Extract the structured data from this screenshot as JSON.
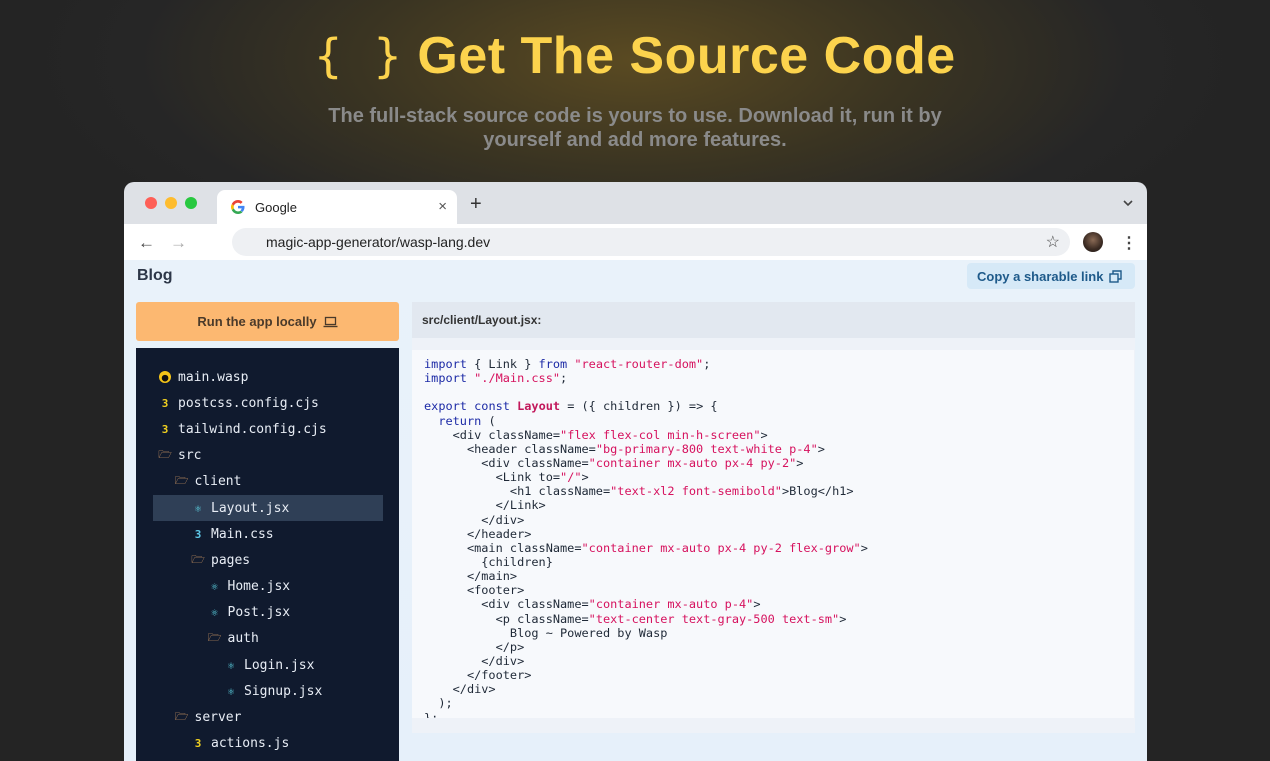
{
  "hero": {
    "braces": "{ }",
    "title": "Get The Source Code",
    "subtitle": "The full-stack source code is yours to use. Download it, run it by yourself and add more features."
  },
  "browser": {
    "tab_title": "Google",
    "tab_close": "×",
    "new_tab": "+",
    "back": "←",
    "forward": "→",
    "url": "magic-app-generator/wasp-lang.dev",
    "star": "☆",
    "menu": "⋮"
  },
  "app": {
    "title": "Blog",
    "copy_link_label": "Copy a sharable link",
    "run_button_label": "Run the app locally",
    "file_path": "src/client/Layout.jsx:"
  },
  "file_tree": [
    {
      "label": "main.wasp",
      "icon": "wasp-icon",
      "glyph": "●",
      "depth": 0,
      "selected": false
    },
    {
      "label": "postcss.config.cjs",
      "icon": "css-icon",
      "glyph": "3",
      "depth": 0,
      "selected": false
    },
    {
      "label": "tailwind.config.cjs",
      "icon": "css-icon",
      "glyph": "3",
      "depth": 0,
      "selected": false
    },
    {
      "label": "src",
      "icon": "folder-open-icon",
      "glyph": "🗁",
      "depth": 0,
      "selected": false
    },
    {
      "label": "client",
      "icon": "folder-open-icon",
      "glyph": "🗁",
      "depth": 1,
      "selected": false
    },
    {
      "label": "Layout.jsx",
      "icon": "react-icon",
      "glyph": "⚛",
      "depth": 2,
      "selected": true
    },
    {
      "label": "Main.css",
      "icon": "css-file-icon",
      "glyph": "3",
      "depth": 2,
      "selected": false
    },
    {
      "label": "pages",
      "icon": "folder-open-icon",
      "glyph": "🗁",
      "depth": 2,
      "selected": false
    },
    {
      "label": "Home.jsx",
      "icon": "react-icon",
      "glyph": "⚛",
      "depth": 3,
      "selected": false
    },
    {
      "label": "Post.jsx",
      "icon": "react-icon",
      "glyph": "⚛",
      "depth": 3,
      "selected": false
    },
    {
      "label": "auth",
      "icon": "folder-open-icon",
      "glyph": "🗁",
      "depth": 3,
      "selected": false
    },
    {
      "label": "Login.jsx",
      "icon": "react-icon",
      "glyph": "⚛",
      "depth": 4,
      "selected": false
    },
    {
      "label": "Signup.jsx",
      "icon": "react-icon",
      "glyph": "⚛",
      "depth": 4,
      "selected": false
    },
    {
      "label": "server",
      "icon": "folder-open-icon",
      "glyph": "🗁",
      "depth": 1,
      "selected": false
    },
    {
      "label": "actions.js",
      "icon": "js-icon",
      "glyph": "3",
      "depth": 2,
      "selected": false
    }
  ],
  "code_lines": [
    [
      [
        "kw",
        "import"
      ],
      [
        "plain",
        " { Link } "
      ],
      [
        "kw",
        "from"
      ],
      [
        "plain",
        " "
      ],
      [
        "str",
        "\"react-router-dom\""
      ],
      [
        "plain",
        ";"
      ]
    ],
    [
      [
        "kw",
        "import"
      ],
      [
        "plain",
        " "
      ],
      [
        "str",
        "\"./Main.css\""
      ],
      [
        "plain",
        ";"
      ]
    ],
    [],
    [
      [
        "kw",
        "export"
      ],
      [
        "plain",
        " "
      ],
      [
        "kw",
        "const"
      ],
      [
        "plain",
        " "
      ],
      [
        "fn",
        "Layout"
      ],
      [
        "plain",
        " = ({ children }) => {"
      ]
    ],
    [
      [
        "plain",
        "  "
      ],
      [
        "kw",
        "return"
      ],
      [
        "plain",
        " ("
      ]
    ],
    [
      [
        "plain",
        "    <div className="
      ],
      [
        "str",
        "\"flex flex-col min-h-screen\""
      ],
      [
        "plain",
        ">"
      ]
    ],
    [
      [
        "plain",
        "      <header className="
      ],
      [
        "str",
        "\"bg-primary-800 text-white p-4\""
      ],
      [
        "plain",
        ">"
      ]
    ],
    [
      [
        "plain",
        "        <div className="
      ],
      [
        "str",
        "\"container mx-auto px-4 py-2\""
      ],
      [
        "plain",
        ">"
      ]
    ],
    [
      [
        "plain",
        "          <Link to="
      ],
      [
        "str",
        "\"/\""
      ],
      [
        "plain",
        ">"
      ]
    ],
    [
      [
        "plain",
        "            <h1 className="
      ],
      [
        "str",
        "\"text-xl2 font-semibold\""
      ],
      [
        "plain",
        ">Blog</h1>"
      ]
    ],
    [
      [
        "plain",
        "          </Link>"
      ]
    ],
    [
      [
        "plain",
        "        </div>"
      ]
    ],
    [
      [
        "plain",
        "      </header>"
      ]
    ],
    [
      [
        "plain",
        "      <main className="
      ],
      [
        "str",
        "\"container mx-auto px-4 py-2 flex-grow\""
      ],
      [
        "plain",
        ">"
      ]
    ],
    [
      [
        "plain",
        "        {children}"
      ]
    ],
    [
      [
        "plain",
        "      </main>"
      ]
    ],
    [
      [
        "plain",
        "      <footer>"
      ]
    ],
    [
      [
        "plain",
        "        <div className="
      ],
      [
        "str",
        "\"container mx-auto p-4\""
      ],
      [
        "plain",
        ">"
      ]
    ],
    [
      [
        "plain",
        "          <p className="
      ],
      [
        "str",
        "\"text-center text-gray-500 text-sm\""
      ],
      [
        "plain",
        ">"
      ]
    ],
    [
      [
        "plain",
        "            Blog ~ Powered by Wasp"
      ]
    ],
    [
      [
        "plain",
        "          </p>"
      ]
    ],
    [
      [
        "plain",
        "        </div>"
      ]
    ],
    [
      [
        "plain",
        "      </footer>"
      ]
    ],
    [
      [
        "plain",
        "    </div>"
      ]
    ],
    [
      [
        "plain",
        "  );"
      ]
    ],
    [
      [
        "plain",
        "};"
      ]
    ]
  ]
}
